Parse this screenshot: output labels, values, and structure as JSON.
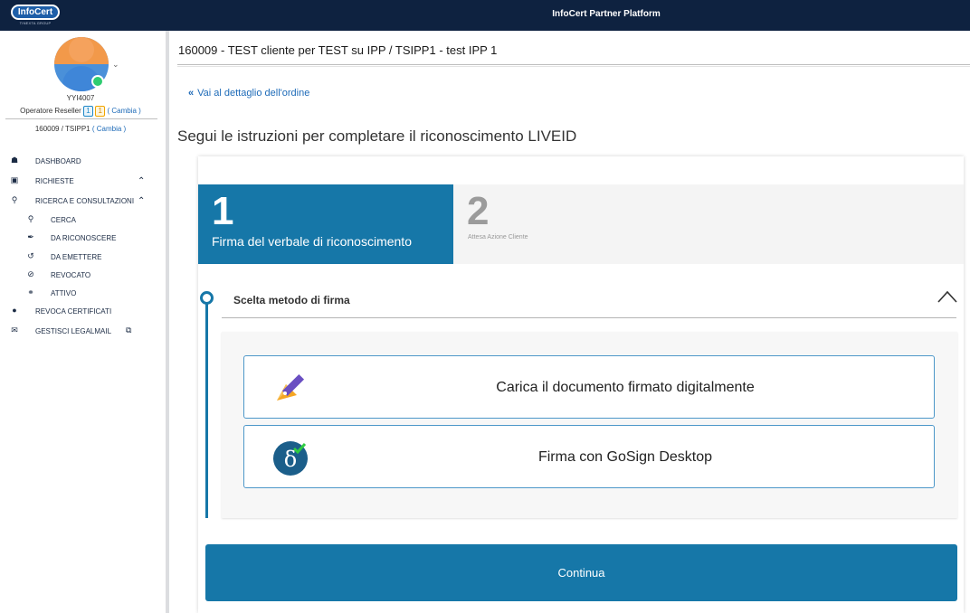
{
  "app": {
    "logo_text": "InfoCert",
    "logo_sub": "TINEXTA GROUP",
    "title": "InfoCert Partner Platform"
  },
  "user": {
    "username": "YYI4007",
    "role": "Operatore Reseller",
    "badge_blue": "1",
    "badge_orange": "1",
    "change_label": "( Cambia )",
    "order": "160009  / TSIPP1",
    "order_change_label": "( Cambia )"
  },
  "sidebar": {
    "items": [
      {
        "label": "DASHBOARD",
        "icon": "home-icon"
      },
      {
        "label": "RICHIESTE",
        "icon": "briefcase-icon"
      },
      {
        "label": "RICERCA E CONSULTAZIONI",
        "icon": "search-zoom-icon"
      },
      {
        "label": "CERCA",
        "icon": "search-icon"
      },
      {
        "label": "DA RICONOSCERE",
        "icon": "pen-icon"
      },
      {
        "label": "DA EMETTERE",
        "icon": "spinner-icon"
      },
      {
        "label": "REVOCATO",
        "icon": "ban-icon"
      },
      {
        "label": "ATTIVO",
        "icon": "plug-icon"
      },
      {
        "label": "REVOCA CERTIFICATI",
        "icon": "certificate-icon"
      },
      {
        "label": "GESTISCI LEGALMAIL",
        "icon": "mail-users-icon"
      }
    ]
  },
  "main": {
    "header": "160009 - TEST cliente per TEST su IPP  / TSIPP1 - test IPP 1",
    "back_link": "Vai al dettaglio dell'ordine",
    "instructions": "Segui le istruzioni per completare il riconoscimento LIVEID"
  },
  "stepper": {
    "steps": [
      {
        "number": "1",
        "label": "Firma del verbale di riconoscimento"
      },
      {
        "number": "2",
        "label": "Attesa Azione Cliente"
      }
    ]
  },
  "section": {
    "title": "Scelta metodo di firma",
    "options": [
      {
        "label": "Carica il documento firmato digitalmente",
        "icon": "upload-pen-icon"
      },
      {
        "label": "Firma con GoSign Desktop",
        "icon": "gosign-icon"
      }
    ]
  },
  "actions": {
    "continue_label": "Continua"
  },
  "colors": {
    "topbar": "#0e2240",
    "primary": "#1677a8",
    "link": "#1e6bb8"
  }
}
